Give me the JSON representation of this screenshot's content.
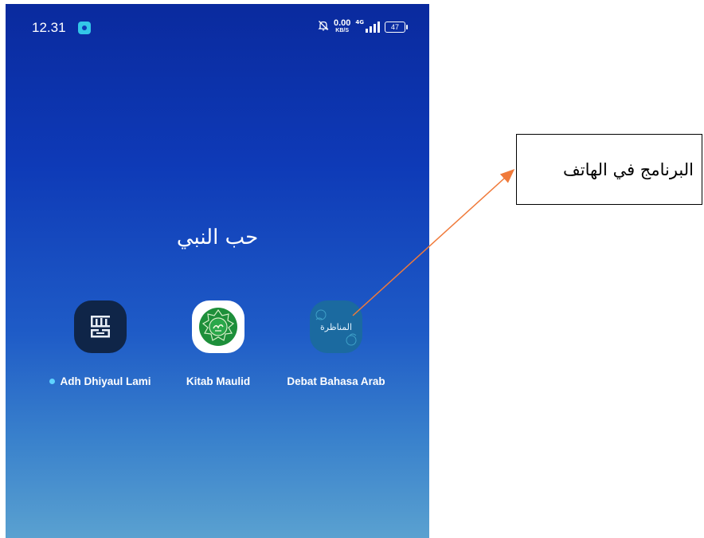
{
  "status_bar": {
    "time": "12.31",
    "net_speed_value": "0.00",
    "net_speed_unit": "KB/S",
    "network_type": "4G",
    "battery": "47"
  },
  "folder": {
    "title": "حب النبي",
    "apps": [
      {
        "label": "Adh Dhiyaul Lami",
        "icon": "adh-dhiyaul-lami-app-icon",
        "has_new_dot": true
      },
      {
        "label": "Kitab Maulid",
        "icon": "kitab-maulid-app-icon",
        "has_new_dot": false
      },
      {
        "label": "Debat Bahasa Arab",
        "icon": "debat-bahasa-arab-app-icon",
        "has_new_dot": false
      }
    ]
  },
  "icon_texts": {
    "debat": "المناظرة"
  },
  "callout": {
    "text": "البرنامج في الهاتف"
  },
  "colors": {
    "arrow": "#f07a3a",
    "notification_dot": "#5fd3ff"
  }
}
